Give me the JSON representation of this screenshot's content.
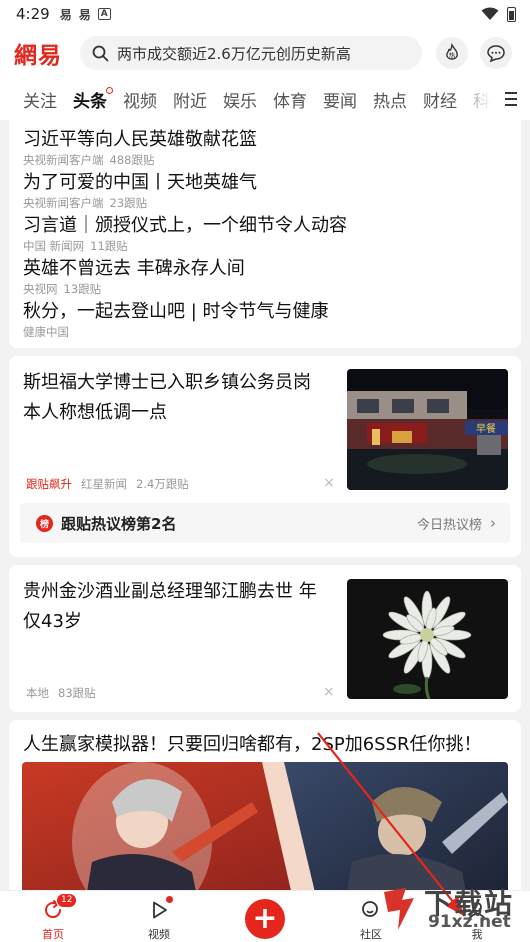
{
  "status_bar": {
    "time": "4:29",
    "icon_1": "易",
    "icon_2": "易",
    "icon_3": "A"
  },
  "header": {
    "logo": "網易",
    "search_placeholder": "两市成交额近2.6万亿元创历史新高",
    "hot_icon": "热"
  },
  "tabs": [
    "关注",
    "头条",
    "视频",
    "附近",
    "娱乐",
    "体育",
    "要闻",
    "热点",
    "财经",
    "科"
  ],
  "headlines": [
    {
      "title": "习近平等向人民英雄敬献花篮",
      "source": "央视新闻客户端",
      "follows": "488跟贴"
    },
    {
      "title": "为了可爱的中国丨天地英雄气",
      "source": "央视新闻客户端",
      "follows": "23跟贴"
    },
    {
      "title": "习言道｜颁授仪式上，一个细节令人动容",
      "source": "中国 新闻网",
      "follows": "11跟贴"
    },
    {
      "title": "英雄不曾远去 丰碑永存人间",
      "source": "央视网",
      "follows": "13跟贴"
    },
    {
      "title": "秋分，一起去登山吧 | 时令节气与健康",
      "source": "健康中国",
      "follows": ""
    }
  ],
  "article1": {
    "title": "斯坦福大学博士已入职乡镇公务员岗本人称想低调一点",
    "tag": "跟贴飙升",
    "source": "红星新闻",
    "follows": "2.4万跟贴",
    "close": "×",
    "hot_badge": "榜",
    "hot_label": "跟贴热议榜第2名",
    "hot_link": "今日热议榜",
    "chevron": "›",
    "image_sign": "早餐"
  },
  "article2": {
    "title": "贵州金沙酒业副总经理邹江鹏去世 年仅43岁",
    "source": "本地",
    "follows": "83跟贴",
    "close": "×"
  },
  "ad": {
    "title": "人生赢家模拟器！只要回归啥都有，2SP加6SSR任你挑！"
  },
  "bottom_nav": {
    "home": "首页",
    "home_badge": "12",
    "video": "视频",
    "publish": "+",
    "community": "社区",
    "mine": "我"
  },
  "watermark": {
    "line1": "下载站",
    "line2": "91xz.net"
  },
  "colors": {
    "brand": "#e4261c"
  }
}
